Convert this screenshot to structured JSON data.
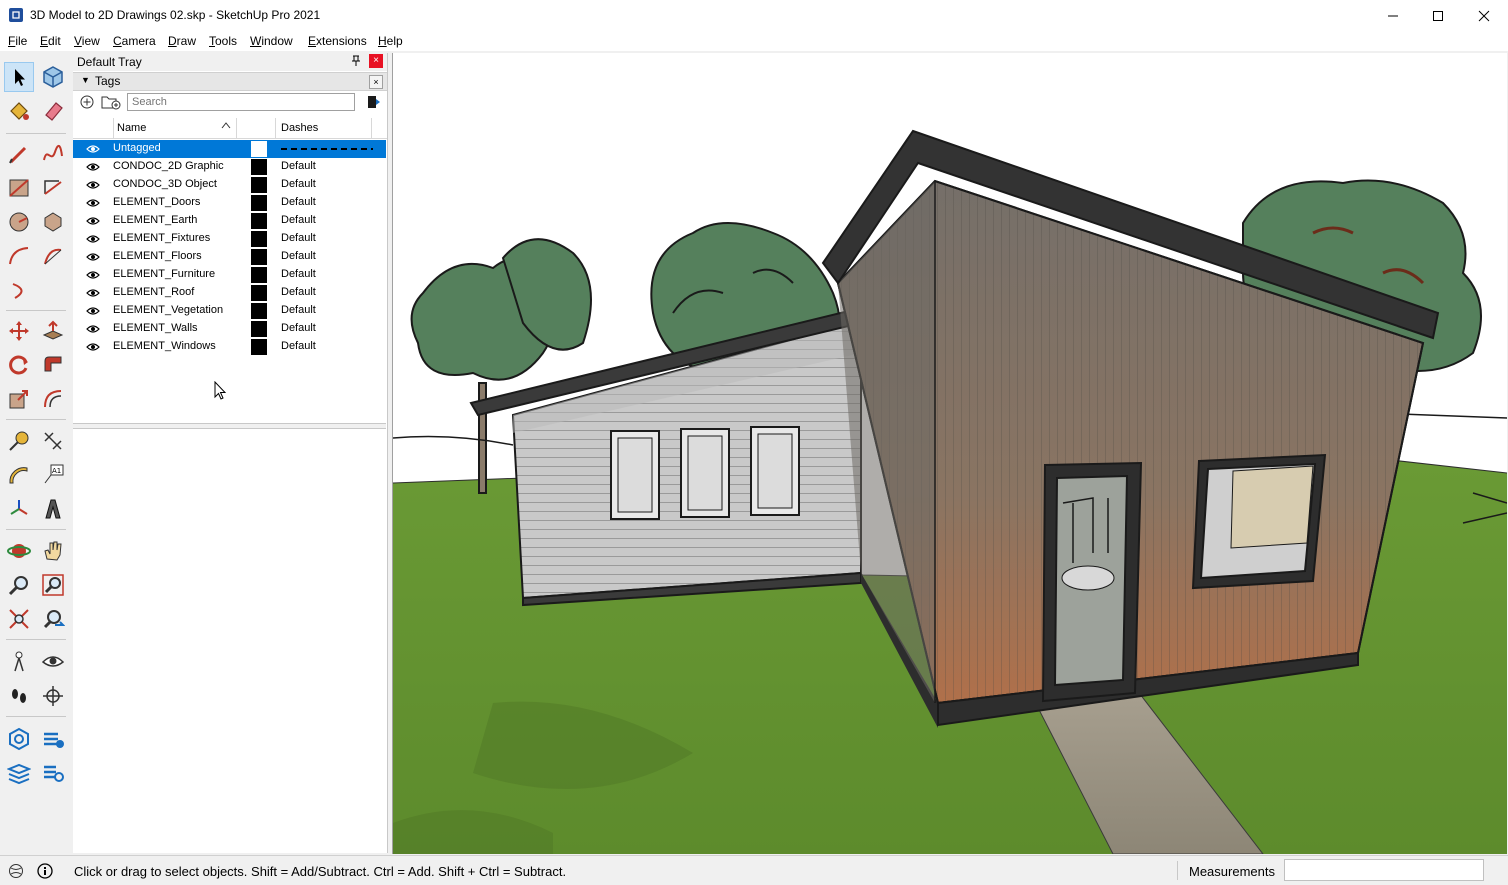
{
  "window": {
    "title": "3D Model to 2D Drawings 02.skp - SketchUp Pro 2021"
  },
  "menu": [
    {
      "label": "File",
      "u": "F",
      "rest": "ile"
    },
    {
      "label": "Edit",
      "u": "E",
      "rest": "dit"
    },
    {
      "label": "View",
      "u": "V",
      "rest": "iew"
    },
    {
      "label": "Camera",
      "u": "C",
      "rest": "amera"
    },
    {
      "label": "Draw",
      "u": "D",
      "rest": "raw"
    },
    {
      "label": "Tools",
      "u": "T",
      "rest": "ools"
    },
    {
      "label": "Window",
      "u": "W",
      "rest": "indow"
    },
    {
      "label": "Extensions",
      "u": "E",
      "rest": "xtensions"
    },
    {
      "label": "Help",
      "u": "H",
      "rest": "elp"
    }
  ],
  "tray": {
    "title": "Default Tray",
    "panel_title": "Tags",
    "search_placeholder": "Search",
    "col_name": "Name",
    "col_dashes": "Dashes",
    "tags": [
      {
        "name": "Untagged",
        "dashes": "",
        "selected": true
      },
      {
        "name": "CONDOC_2D Graphic",
        "dashes": "Default"
      },
      {
        "name": "CONDOC_3D Object",
        "dashes": "Default"
      },
      {
        "name": "ELEMENT_Doors",
        "dashes": "Default"
      },
      {
        "name": "ELEMENT_Earth",
        "dashes": "Default"
      },
      {
        "name": "ELEMENT_Fixtures",
        "dashes": "Default"
      },
      {
        "name": "ELEMENT_Floors",
        "dashes": "Default"
      },
      {
        "name": "ELEMENT_Furniture",
        "dashes": "Default"
      },
      {
        "name": "ELEMENT_Roof",
        "dashes": "Default"
      },
      {
        "name": "ELEMENT_Vegetation",
        "dashes": "Default"
      },
      {
        "name": "ELEMENT_Walls",
        "dashes": "Default"
      },
      {
        "name": "ELEMENT_Windows",
        "dashes": "Default"
      }
    ]
  },
  "status": {
    "hint": "Click or drag to select objects. Shift = Add/Subtract. Ctrl = Add. Shift + Ctrl = Subtract.",
    "measurements_label": "Measurements",
    "measurements_value": ""
  },
  "colors": {
    "selection": "#0078d7",
    "close_red": "#e81123",
    "grass": "#6f9a3a",
    "tree_green": "#55805c"
  }
}
